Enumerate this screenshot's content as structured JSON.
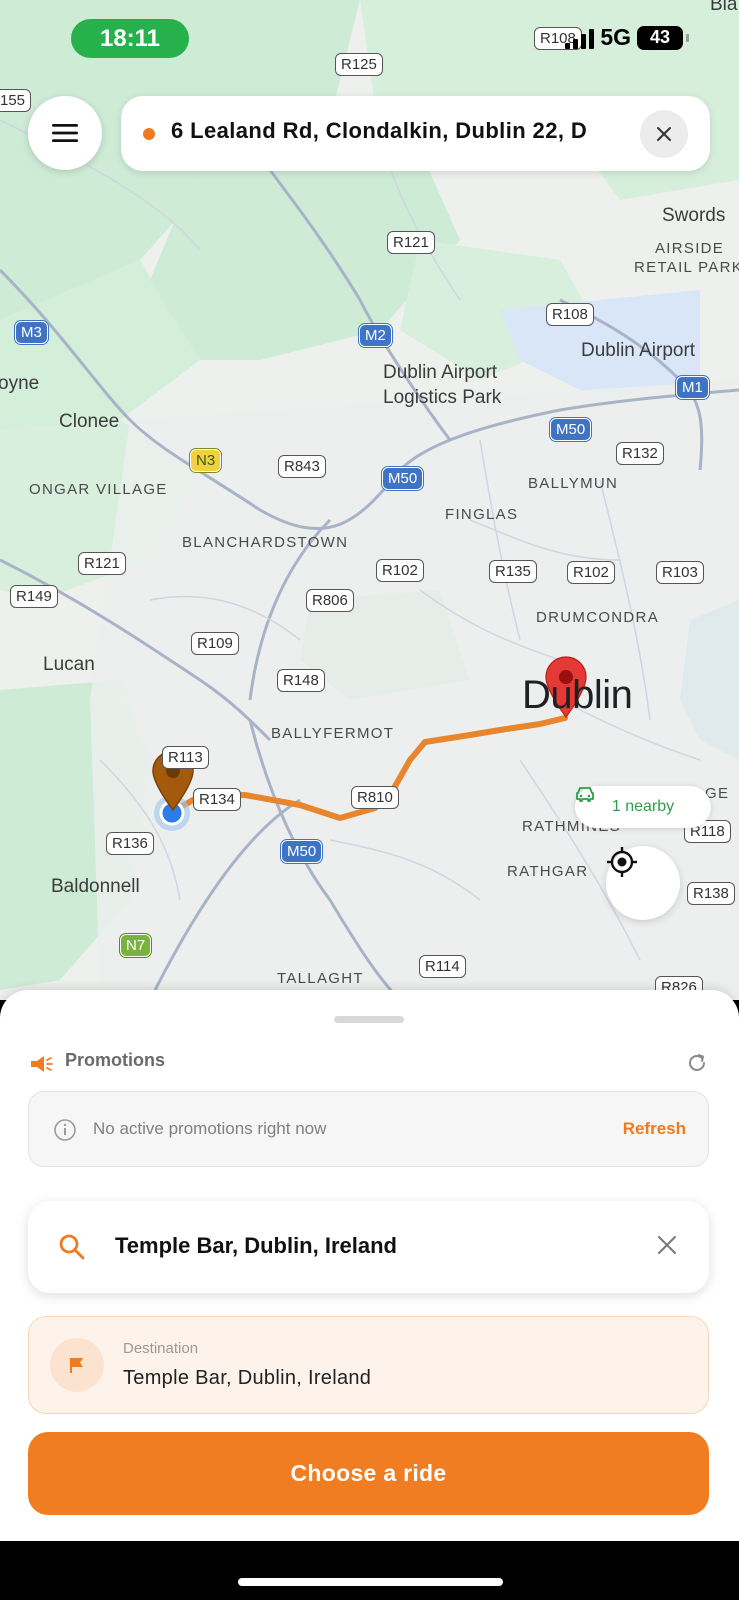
{
  "status_bar": {
    "time": "18:11",
    "network": "5G",
    "battery": "43"
  },
  "top_search": {
    "address": "6 Lealand Rd, Clondalkin, Dublin 22, D"
  },
  "map": {
    "place_labels": {
      "swords": "Swords",
      "airside": "AIRSIDE",
      "retail_park": "RETAIL PARK",
      "dublin_airport": "Dublin Airport",
      "logistics_1": "Dublin Airport",
      "logistics_2": "Logistics Park",
      "clonee": "Clonee",
      "boyne": "oyne",
      "ongar": "ONGAR VILLAGE",
      "blanchardstown": "BLANCHARDSTOWN",
      "ballymun": "BALLYMUN",
      "finglas": "FINGLAS",
      "drumcondra": "DRUMCONDRA",
      "lucan": "Lucan",
      "ballyfermot": "BALLYFERMOT",
      "dublin": "Dublin",
      "rathmines": "RATHMINES",
      "rathgar": "RATHGAR",
      "baldonnell": "Baldonnell",
      "tallaght": "TALLAGHT",
      "bla": "Bla",
      "ge": "GE"
    },
    "road_shields": {
      "r108a": "R108",
      "r125": "R125",
      "r155": "155",
      "r121a": "R121",
      "r108b": "R108",
      "m3": "M3",
      "m2": "M2",
      "m1": "M1",
      "m50a": "M50",
      "m50b": "M50",
      "m50c": "M50",
      "r132": "R132",
      "n3": "N3",
      "r843": "R843",
      "r121b": "R121",
      "r102a": "R102",
      "r135": "R135",
      "r102b": "R102",
      "r103": "R103",
      "r149": "R149",
      "r806": "R806",
      "r109": "R109",
      "r148": "R148",
      "r113": "R113",
      "r134": "R134",
      "r810": "R810",
      "r136": "R136",
      "r118": "R118",
      "r138": "R138",
      "n7": "N7",
      "r114": "R114",
      "r826": "R826"
    },
    "nearby": "1 nearby"
  },
  "promotions": {
    "title": "Promotions",
    "empty_message": "No active promotions right now",
    "refresh_label": "Refresh"
  },
  "destination_search": {
    "value": "Temple Bar, Dublin, Ireland"
  },
  "destination_card": {
    "caption": "Destination",
    "name": "Temple Bar, Dublin, Ireland"
  },
  "cta": {
    "label": "Choose a ride"
  },
  "colors": {
    "accent": "#f17d22",
    "map_green": "#cdebd5",
    "route": "#e8862e",
    "pin_red": "#e53935"
  }
}
